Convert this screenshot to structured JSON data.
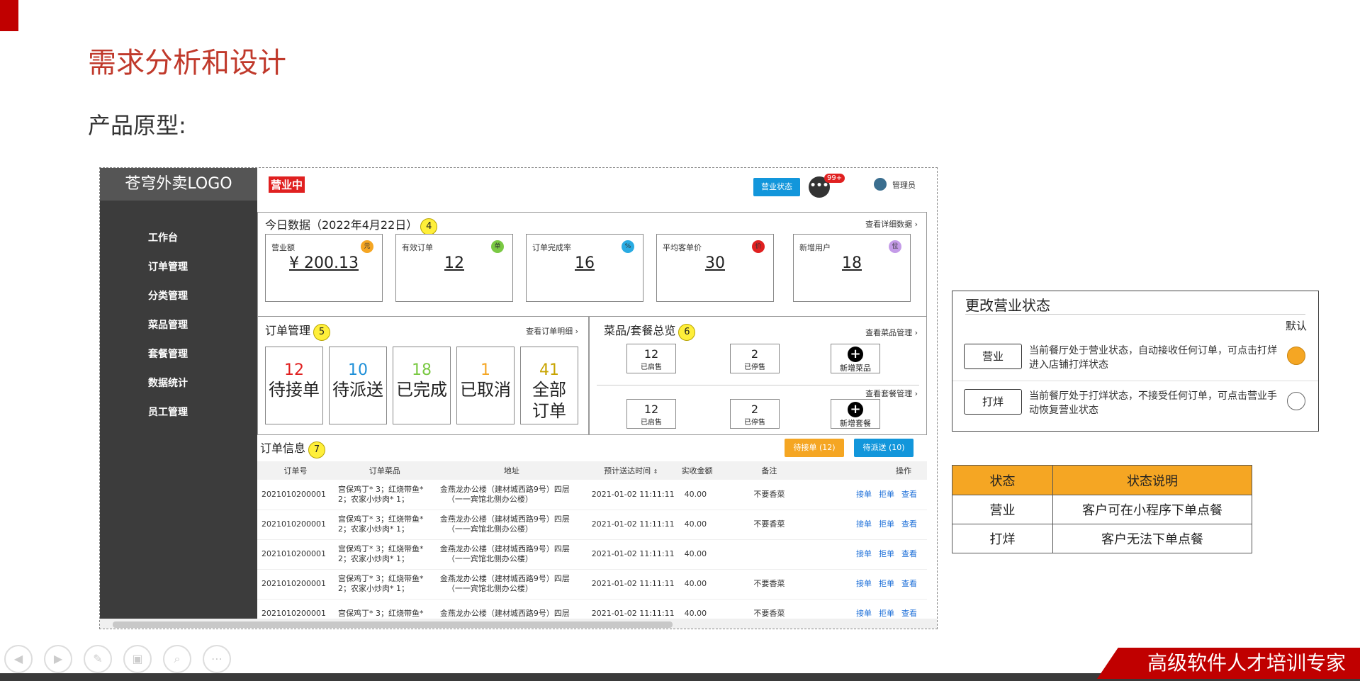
{
  "slide": {
    "title": "需求分析和设计",
    "subtitle": "产品原型:"
  },
  "app": {
    "logo": "苍穹外卖LOGO",
    "nav": [
      "工作台",
      "订单管理",
      "分类管理",
      "菜品管理",
      "套餐管理",
      "数据统计",
      "员工管理"
    ],
    "open_tag": "营业中",
    "status_button": "营业状态",
    "msg_icon": "chat-icon",
    "msg_count": "99+",
    "admin": "管理员"
  },
  "today": {
    "title": "今日数据（2022年4月22日）",
    "num": "4",
    "more": "查看详细数据",
    "cards": [
      {
        "label": "营业额",
        "value": "¥ 200.13",
        "icon": "元",
        "color": "#f5a623"
      },
      {
        "label": "有效订单",
        "value": "12",
        "icon": "单",
        "color": "#7ac943"
      },
      {
        "label": "订单完成率",
        "value": "16",
        "icon": "%",
        "color": "#29abe2"
      },
      {
        "label": "平均客单价",
        "value": "30",
        "icon": "价",
        "color": "#e02020"
      },
      {
        "label": "新增用户",
        "value": "18",
        "icon": "位",
        "color": "#c49be8"
      }
    ]
  },
  "orders": {
    "title": "订单管理",
    "num": "5",
    "more": "查看订单明细",
    "boxes": [
      {
        "n": "12",
        "t": "待接单",
        "color": "#e02020"
      },
      {
        "n": "10",
        "t": "待派送",
        "color": "#1d8fd8"
      },
      {
        "n": "18",
        "t": "已完成",
        "color": "#7ac943"
      },
      {
        "n": "1",
        "t": "已取消",
        "color": "#f5a623"
      },
      {
        "n": "41",
        "t": "全部订单",
        "color": "#c8a400"
      }
    ]
  },
  "dishes": {
    "title": "菜品/套餐总览",
    "num": "6",
    "more": "查看菜品管理",
    "more2": "查看套餐管理",
    "dish_on": "12",
    "dish_on_label": "已启售",
    "dish_off": "2",
    "dish_off_label": "已停售",
    "add_dish": "新增菜品",
    "set_on": "12",
    "set_on_label": "已启售",
    "set_off": "2",
    "set_off_label": "已停售",
    "add_set": "新增套餐"
  },
  "info": {
    "title": "订单信息",
    "num": "7",
    "btn_wait": "待接单 (12)",
    "btn_deliver": "待派送 (10)",
    "headers": [
      "订单号",
      "订单菜品",
      "地址",
      "预计送达时间",
      "实收金额",
      "备注",
      "操作"
    ],
    "rows": [
      {
        "id": "2021010200001",
        "dish1": "宫保鸡丁* 3；红烧带鱼*",
        "dish2": "2；农家小炒肉* 1；",
        "addr1": "金燕龙办公楼（建材城西路9号）四层",
        "addr2": "（一一宾馆北侧办公楼）",
        "time": "2021-01-02 11:11:11",
        "amt": "40.00",
        "note": "不要香菜"
      },
      {
        "id": "2021010200001",
        "dish1": "宫保鸡丁* 3；红烧带鱼*",
        "dish2": "2；农家小炒肉* 1；",
        "addr1": "金燕龙办公楼（建材城西路9号）四层",
        "addr2": "（一一宾馆北侧办公楼）",
        "time": "2021-01-02 11:11:11",
        "amt": "40.00",
        "note": "不要香菜"
      },
      {
        "id": "2021010200001",
        "dish1": "宫保鸡丁* 3；红烧带鱼*",
        "dish2": "2；农家小炒肉* 1；",
        "addr1": "金燕龙办公楼（建材城西路9号）四层",
        "addr2": "（一一宾馆北侧办公楼）",
        "time": "2021-01-02 11:11:11",
        "amt": "40.00",
        "note": ""
      },
      {
        "id": "2021010200001",
        "dish1": "宫保鸡丁* 3；红烧带鱼*",
        "dish2": "2；农家小炒肉* 1；",
        "addr1": "金燕龙办公楼（建材城西路9号）四层",
        "addr2": "（一一宾馆北侧办公楼）",
        "time": "2021-01-02 11:11:11",
        "amt": "40.00",
        "note": "不要香菜"
      },
      {
        "id": "2021010200001",
        "dish1": "宫保鸡丁* 3；红烧带鱼*",
        "dish2": "",
        "addr1": "金燕龙办公楼（建材城西路9号）四层",
        "addr2": "",
        "time": "2021-01-02 11:11:11",
        "amt": "40.00",
        "note": "不要香菜"
      }
    ],
    "ops": [
      "接单",
      "拒单",
      "查看"
    ]
  },
  "change": {
    "title": "更改营业状态",
    "default": "默认",
    "open_btn": "营业",
    "open_desc": "当前餐厅处于营业状态，自动接收任何订单，可点击打烊进入店铺打烊状态",
    "open_color": "#f5a623",
    "close_btn": "打烊",
    "close_desc": "当前餐厅处于打烊状态，不接受任何订单，可点击营业手动恢复营业状态"
  },
  "status_table": {
    "headers": [
      "状态",
      "状态说明"
    ],
    "rows": [
      [
        "营业",
        "客户可在小程序下单点餐"
      ],
      [
        "打烊",
        "客户无法下单点餐"
      ]
    ]
  },
  "brand": "高级软件人才培训专家"
}
